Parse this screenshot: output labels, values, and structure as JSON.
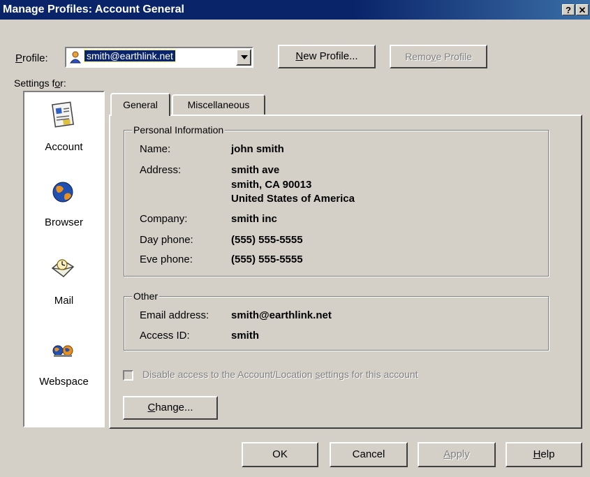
{
  "window": {
    "title": "Manage Profiles: Account General",
    "help_glyph": "?",
    "close_glyph": "✕"
  },
  "profile": {
    "label_prefix": "P",
    "label_rest": "rofile:",
    "selected": "smith@earthlink.net",
    "new_button": {
      "prefix": "",
      "ul": "N",
      "rest": "ew Profile..."
    },
    "remove_button": {
      "prefix": "Remo",
      "ul": "v",
      "rest": "e Profile"
    }
  },
  "settings_for": {
    "prefix": "Settings f",
    "ul": "o",
    "rest": "r:"
  },
  "sidebar": {
    "items": [
      {
        "label": "Account",
        "icon": "account-card-icon"
      },
      {
        "label": "Browser",
        "icon": "globe-icon"
      },
      {
        "label": "Mail",
        "icon": "mail-clock-icon"
      },
      {
        "label": "Webspace",
        "icon": "webspace-icon"
      }
    ]
  },
  "tabs": [
    {
      "label": "General"
    },
    {
      "label": "Miscellaneous"
    }
  ],
  "personal": {
    "legend": "Personal Information",
    "name_label": "Name:",
    "name_value": "john smith",
    "address_label": "Address:",
    "address_line1": "smith ave",
    "address_line2": "smith, CA 90013",
    "address_line3": "United States of America",
    "company_label": "Company:",
    "company_value": "smith inc",
    "day_label": "Day phone:",
    "day_value": "(555) 555-5555",
    "eve_label": "Eve phone:",
    "eve_value": "(555) 555-5555"
  },
  "other": {
    "legend": "Other",
    "email_label": "Email address:",
    "email_value": "smith@earthlink.net",
    "access_label": "Access ID:",
    "access_value": "smith"
  },
  "disable_checkbox": {
    "prefix": "Disable access to the Account/Location ",
    "ul": "s",
    "rest": "ettings for this account",
    "checked": false
  },
  "change_button": {
    "ul": "C",
    "rest": "hange..."
  },
  "footer": {
    "ok": "OK",
    "cancel": "Cancel",
    "apply_ul": "A",
    "apply_rest": "pply",
    "help_ul": "H",
    "help_rest": "elp"
  }
}
